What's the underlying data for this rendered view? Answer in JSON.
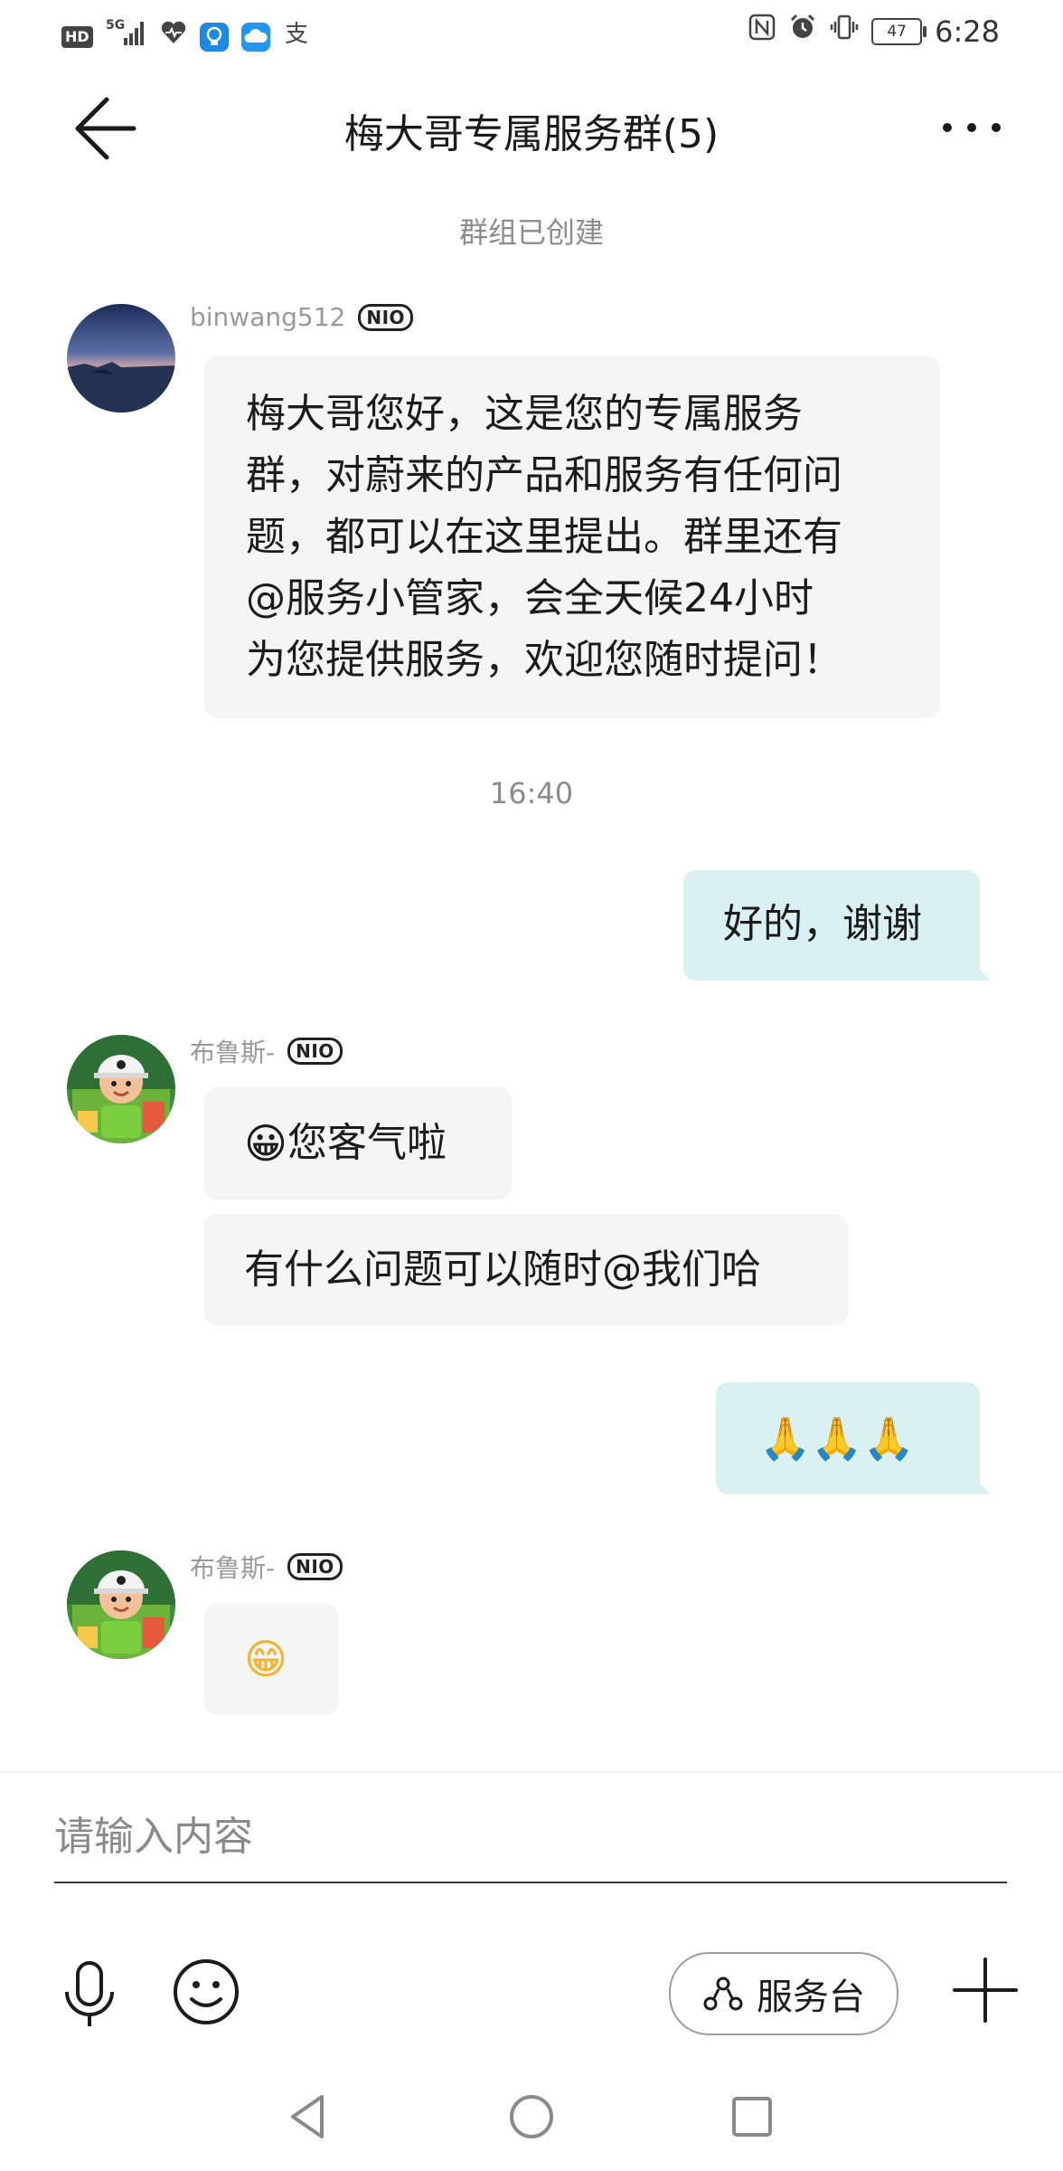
{
  "status_bar": {
    "left_icons": [
      "hd-icon",
      "signal-5g-icon",
      "health-icon",
      "app-bulb-icon",
      "cloud-icon",
      "alipay-icon"
    ],
    "hd_label": "HD",
    "network_label": "5G",
    "battery_level": "47",
    "time": "6:28"
  },
  "header": {
    "title": "梅大哥专属服务群(5)"
  },
  "system_messages": {
    "group_created": "群组已创建",
    "timestamp": "16:40"
  },
  "messages": [
    {
      "direction": "incoming",
      "sender": "binwang512",
      "badge": "NIO",
      "lines": [
        "梅大哥您好，这是您的专属服务",
        "群，对蔚来的产品和服务有任何问",
        "题，都可以在这里提出。群里还有",
        "@服务小管家，会全天候24小时",
        "为您提供服务，欢迎您随时提问！"
      ]
    },
    {
      "direction": "outgoing",
      "text": "好的，谢谢"
    },
    {
      "direction": "incoming",
      "sender": "布鲁斯-",
      "badge": "NIO",
      "emoji": "😀",
      "text": "您客气啦"
    },
    {
      "direction": "incoming",
      "text": "有什么问题可以随时@我们哈"
    },
    {
      "direction": "outgoing",
      "text": "🙏🙏🙏"
    },
    {
      "direction": "incoming",
      "sender": "布鲁斯-",
      "badge": "NIO",
      "text": "😁"
    }
  ],
  "composer": {
    "placeholder": "请输入内容",
    "service_button_label": "服务台"
  },
  "colors": {
    "incoming_bubble": "#f5f5f5",
    "outgoing_bubble": "#d9f1f2",
    "muted_text": "#8c8c8c"
  }
}
